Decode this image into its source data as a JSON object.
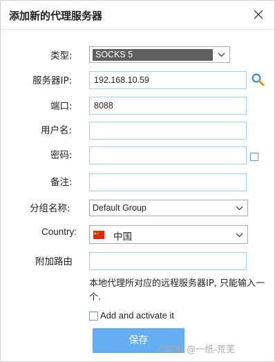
{
  "dialog": {
    "title": "添加新的代理服务器"
  },
  "fields": {
    "type": {
      "label": "类型:",
      "value": "SOCKS 5"
    },
    "server_ip": {
      "label": "服务器IP:",
      "value": "192.168.10.59"
    },
    "port": {
      "label": "端口:",
      "value": "8088"
    },
    "username": {
      "label": "用户名:",
      "value": ""
    },
    "password": {
      "label": "密码:",
      "value": ""
    },
    "note": {
      "label": "备注:",
      "value": ""
    },
    "group": {
      "label": "分组名称:",
      "value": "Default Group"
    },
    "country": {
      "label": "Country:",
      "value": "中国",
      "flag": "cn-flag-icon"
    },
    "extra_route": {
      "label": "附加路由",
      "value": ""
    }
  },
  "hint": "本地代理所对应的远程服务器IP, 只能输入一个.",
  "activate": {
    "label": "Add and activate it",
    "checked": false
  },
  "save_label": "保存",
  "watermark": "CSDN @一纸-荒芜",
  "colors": {
    "accent": "#66aef2",
    "input_border": "#9fd0ee",
    "type_selected_bg": "#606060",
    "flag_red": "#de2910",
    "flag_yellow": "#ffde00"
  }
}
